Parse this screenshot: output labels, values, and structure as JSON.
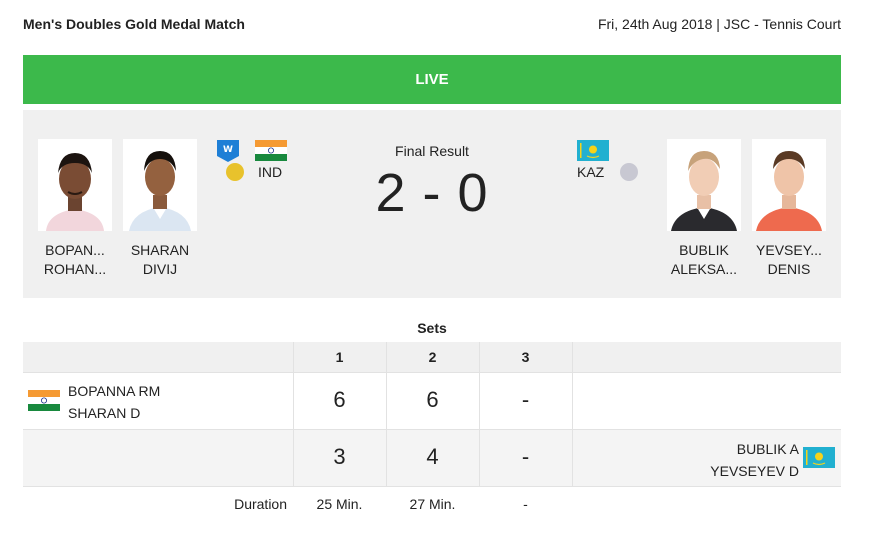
{
  "header": {
    "event_title": "Men's Doubles Gold Medal Match",
    "event_info": "Fri, 24th Aug 2018 | JSC - Tennis Court"
  },
  "status": {
    "label": "LIVE",
    "color": "#3cb94b"
  },
  "result": {
    "label": "Final Result",
    "score": "2 - 0"
  },
  "team_home": {
    "country_code": "IND",
    "medal_color": "#e8c22c",
    "winner_badge": "W",
    "players": [
      {
        "surname": "BOPAN...",
        "given": "ROHAN..."
      },
      {
        "surname": "SHARAN",
        "given": "DIVIJ"
      }
    ]
  },
  "team_away": {
    "country_code": "KAZ",
    "medal_color": "#c8c8d2",
    "players": [
      {
        "surname": "BUBLIK",
        "given": "ALEKSA..."
      },
      {
        "surname": "YEVSEY...",
        "given": "DENIS"
      }
    ]
  },
  "sets": {
    "title": "Sets",
    "columns": [
      "1",
      "2",
      "3"
    ],
    "home": {
      "line1": "BOPANNA RM",
      "line2": "SHARAN D",
      "scores": [
        "6",
        "6",
        "-"
      ]
    },
    "away": {
      "line1": "BUBLIK A",
      "line2": "YEVSEYEV D",
      "scores": [
        "3",
        "4",
        "-"
      ]
    },
    "duration": {
      "label": "Duration",
      "values": [
        "25 Min.",
        "27 Min.",
        "-"
      ]
    }
  }
}
